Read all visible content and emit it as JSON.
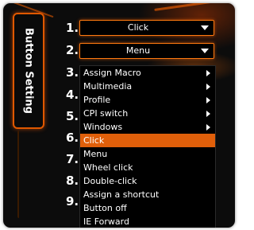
{
  "panel": {
    "title": "Button Setting"
  },
  "slots": [
    {
      "number": "1."
    },
    {
      "number": "2."
    },
    {
      "number": "3."
    },
    {
      "number": "4."
    },
    {
      "number": "5."
    },
    {
      "number": "6."
    },
    {
      "number": "7."
    },
    {
      "number": "8."
    },
    {
      "number": "9."
    }
  ],
  "combos": [
    {
      "value": "Click"
    },
    {
      "value": "Menu"
    }
  ],
  "menu": {
    "items": [
      {
        "label": "Assign Macro",
        "submenu": true
      },
      {
        "label": "Multimedia",
        "submenu": true
      },
      {
        "label": "Profile",
        "submenu": true
      },
      {
        "label": "CPI switch",
        "submenu": true
      },
      {
        "label": "Windows",
        "submenu": true
      },
      {
        "label": "Click",
        "selected": true
      },
      {
        "label": "Menu"
      },
      {
        "label": "Wheel click"
      },
      {
        "label": "Double-click"
      },
      {
        "label": "Assign a shortcut"
      },
      {
        "label": "Button off"
      },
      {
        "label": "IE Forward"
      }
    ]
  },
  "colors": {
    "accent": "#e05800",
    "highlight": "#e05f0a",
    "background": "#0c0c0c"
  }
}
